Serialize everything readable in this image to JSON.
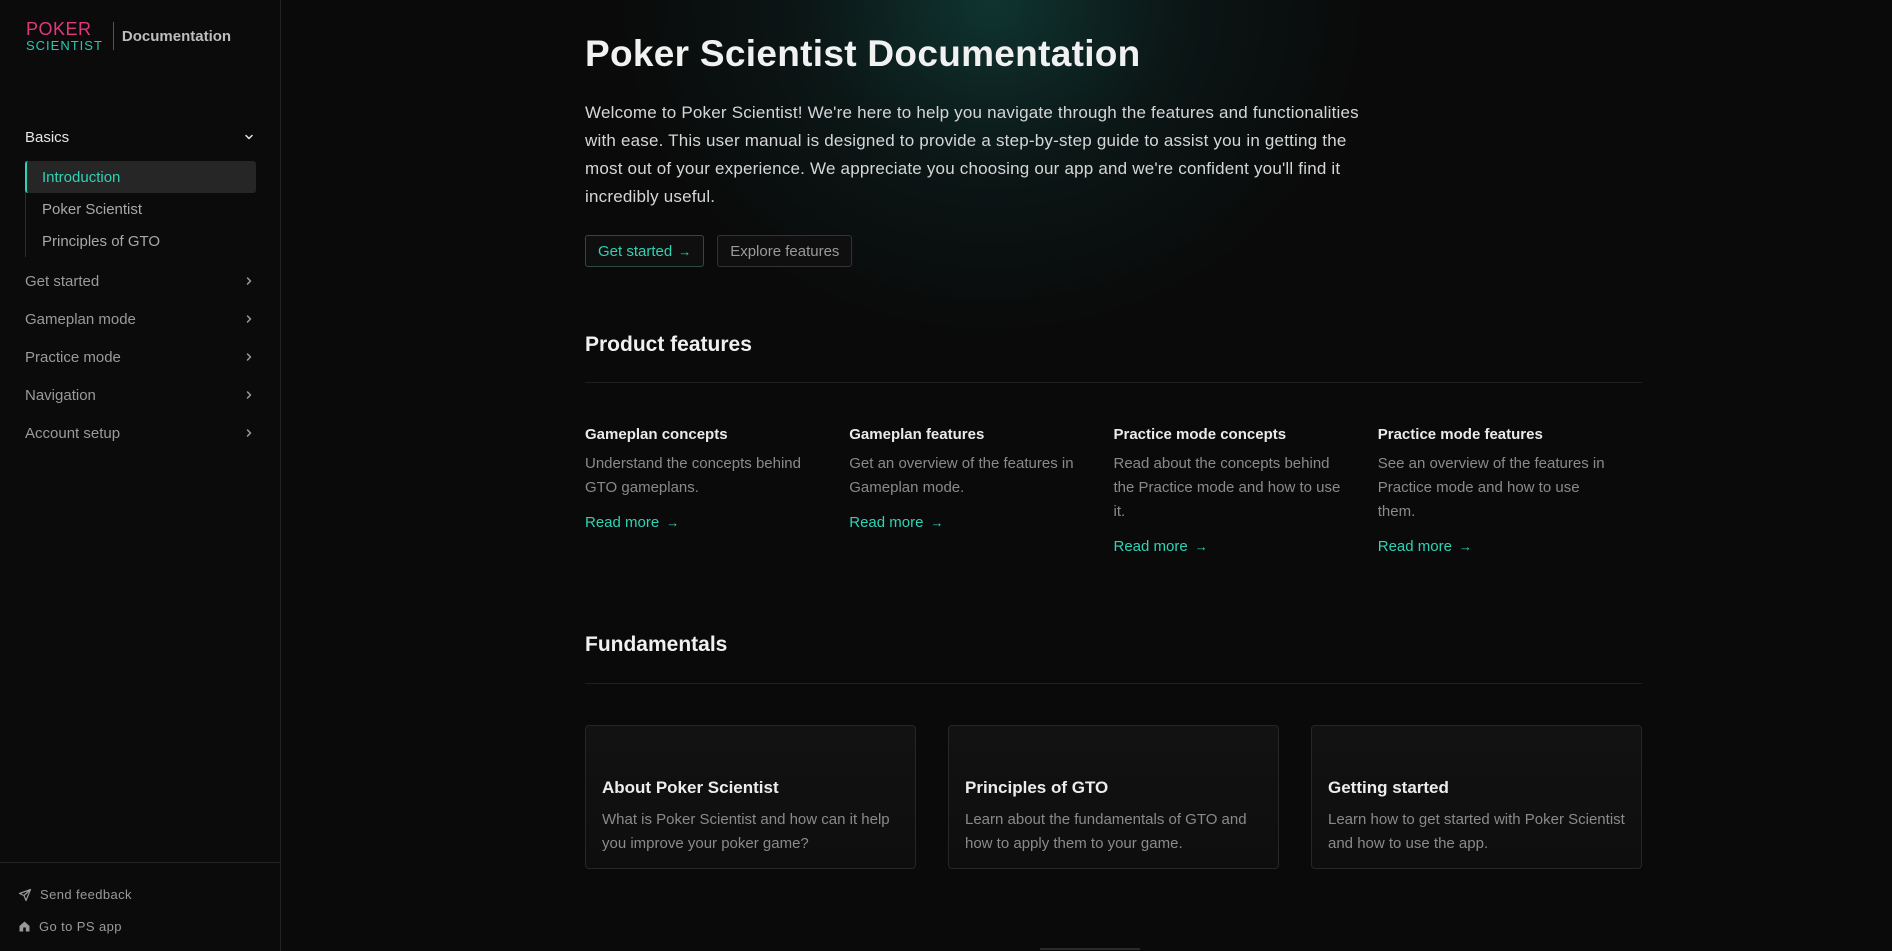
{
  "brand": {
    "logo_line1": "POKER",
    "logo_line2": "SCIENTIST",
    "section": "Documentation"
  },
  "sidebar": {
    "groups": [
      {
        "label": "Basics",
        "open": true,
        "items": [
          "Introduction",
          "Poker Scientist",
          "Principles of GTO"
        ],
        "active_item": "Introduction"
      },
      {
        "label": "Get started",
        "open": false
      },
      {
        "label": "Gameplan mode",
        "open": false
      },
      {
        "label": "Practice mode",
        "open": false
      },
      {
        "label": "Navigation",
        "open": false
      },
      {
        "label": "Account setup",
        "open": false
      }
    ],
    "footer": {
      "feedback": "Send feedback",
      "app": "Go to PS app"
    }
  },
  "main": {
    "title": "Poker Scientist Documentation",
    "intro": "Welcome to Poker Scientist! We're here to help you navigate through the features and functionalities with ease. This user manual is designed to provide a step-by-step guide to assist you in getting the most out of your experience. We appreciate you choosing our app and we're confident you'll find it incredibly useful.",
    "cta_primary": "Get started",
    "cta_secondary": "Explore features",
    "features_title": "Product features",
    "features": [
      {
        "title": "Gameplan concepts",
        "desc": "Understand the concepts behind GTO gameplans.",
        "link": "Read more"
      },
      {
        "title": "Gameplan features",
        "desc": "Get an overview of the features in Gameplan mode.",
        "link": "Read more"
      },
      {
        "title": "Practice mode concepts",
        "desc": "Read about the concepts behind the Practice mode and how to use it.",
        "link": "Read more"
      },
      {
        "title": "Practice mode features",
        "desc": "See an overview of the features in Practice mode and how to use them.",
        "link": "Read more"
      }
    ],
    "fundamentals_title": "Fundamentals",
    "fundamentals": [
      {
        "title": "About Poker Scientist",
        "desc": "What is Poker Scientist and how can it help you improve your poker game?"
      },
      {
        "title": "Principles of GTO",
        "desc": "Learn about the fundamentals of GTO and how to apply them to your game."
      },
      {
        "title": "Getting started",
        "desc": "Learn how to get started with Poker Scientist and how to use the app."
      }
    ]
  },
  "colors": {
    "accent": "#2fd2b5",
    "brand_pink": "#e0397a",
    "background": "#0a0a0a"
  }
}
